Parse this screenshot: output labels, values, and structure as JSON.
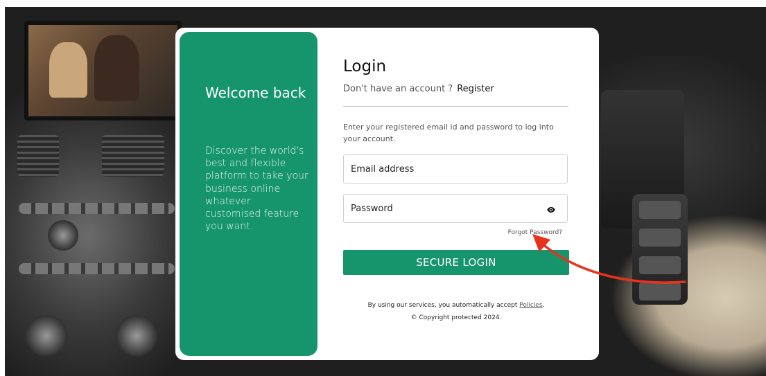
{
  "panel": {
    "welcome": "Welcome back",
    "tagline": "Discover the world's best and flexible platform to take your business online whatever customised feature you want."
  },
  "login": {
    "title": "Login",
    "no_account_text": "Don't have an account ?",
    "register_label": "Register",
    "instructions": "Enter your registered email id and password to log into your account.",
    "email_placeholder": "Email address",
    "password_placeholder": "Password",
    "forgot_label": "Forgot Password?",
    "submit_label": "SECURE LOGIN"
  },
  "footer": {
    "legal_prefix": "By using our services, you automatically accept",
    "policies_link": "Policies",
    "legal_suffix": ".",
    "copyright": "© Copyright protected 2024."
  },
  "icons": {
    "password_toggle": "eye-icon"
  },
  "colors": {
    "accent": "#16956d",
    "annotation": "#e8321e"
  }
}
